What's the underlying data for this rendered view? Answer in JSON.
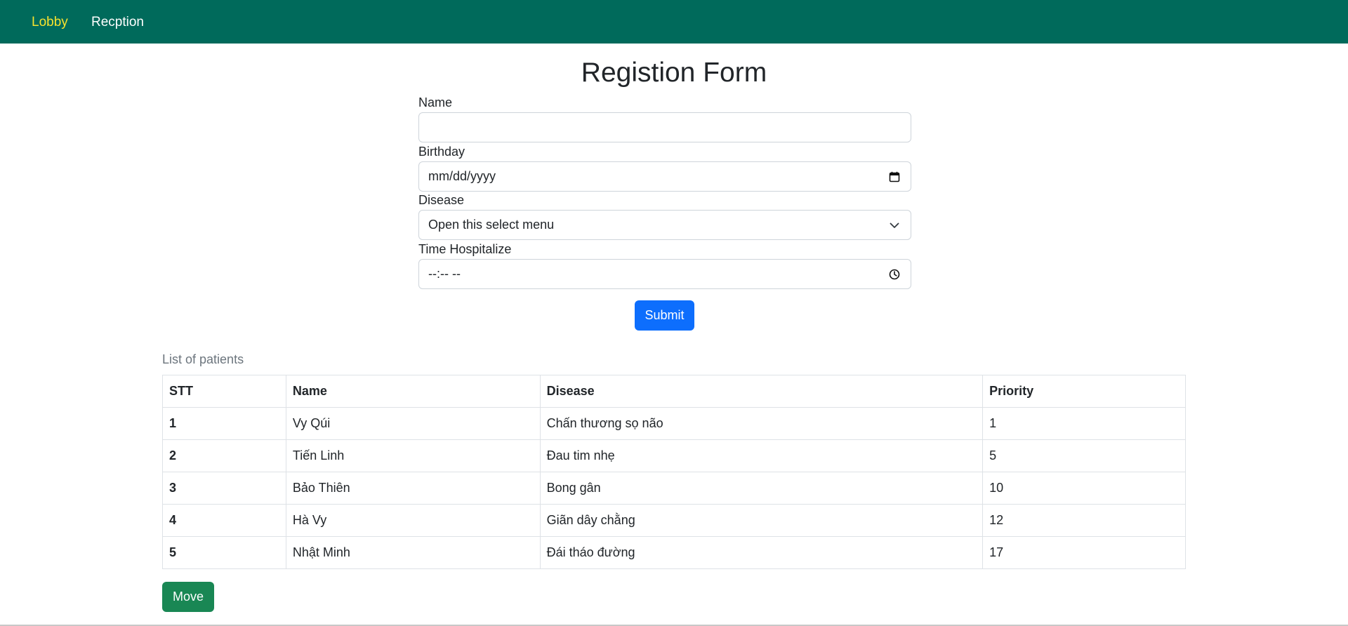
{
  "nav": {
    "lobby_label": "Lobby",
    "reception_label": "Recption",
    "active_color": "#f7e22e",
    "bg_color": "#006a5b"
  },
  "form": {
    "title": "Registion Form",
    "name_label": "Name",
    "name_value": "",
    "birthday_label": "Birthday",
    "birthday_placeholder": "mm/dd/yyyy",
    "birthday_icon": "calendar-icon",
    "disease_label": "Disease",
    "disease_selected": "Open this select menu",
    "disease_icon": "chevron-down-icon",
    "time_label": "Time Hospitalize",
    "time_placeholder": "--:-- --",
    "time_icon": "clock-icon",
    "submit_label": "Submit",
    "submit_color": "#0d6efd"
  },
  "patients": {
    "caption": "List of patients",
    "columns": [
      "STT",
      "Name",
      "Disease",
      "Priority"
    ],
    "rows": [
      {
        "stt": "1",
        "name": "Vy Qúi",
        "disease": "Chấn thương sọ não",
        "priority": "1"
      },
      {
        "stt": "2",
        "name": "Tiến Linh",
        "disease": "Đau tim nhẹ",
        "priority": "5"
      },
      {
        "stt": "3",
        "name": "Bảo Thiên",
        "disease": "Bong gân",
        "priority": "10"
      },
      {
        "stt": "4",
        "name": "Hà Vy",
        "disease": "Giãn dây chằng",
        "priority": "12"
      },
      {
        "stt": "5",
        "name": "Nhật Minh",
        "disease": "Đái tháo đường",
        "priority": "17"
      }
    ]
  },
  "actions": {
    "move_label": "Move",
    "move_color": "#198754"
  }
}
